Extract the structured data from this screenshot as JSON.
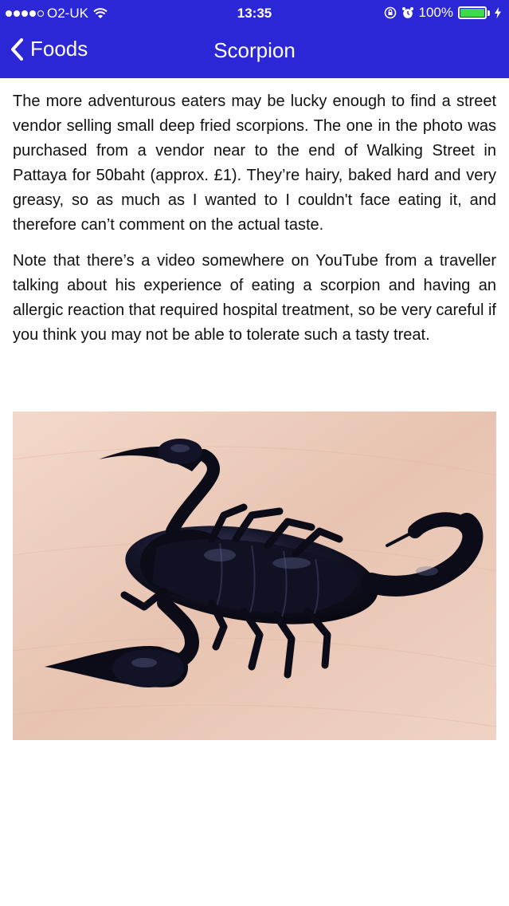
{
  "status_bar": {
    "carrier": "O2-UK",
    "time": "13:35",
    "battery": "100%"
  },
  "nav": {
    "back_label": "Foods",
    "title": "Scorpion"
  },
  "article": {
    "paragraphs": [
      "The more adventurous eaters may be lucky enough to find a street vendor selling small deep fried scorpions. The one in the photo was purchased from a vendor near to the end of Walking Street in Pattaya for 50baht (approx. £1). They’re hairy, baked hard and very greasy, so as much as I wanted to I couldn't face eating it, and therefore can’t comment on the actual taste.",
      "Note that there’s a video somewhere on YouTube from a traveller talking about his experience of eating a scorpion and having an allergic reaction that required hospital treatment, so be very careful if you think you may not be able to tolerate such a tasty treat."
    ]
  },
  "colors": {
    "nav_background": "#2b26d6",
    "text": "#111111",
    "battery_fill": "#3ed94c"
  },
  "icons": [
    "signal-dots",
    "wifi-icon",
    "lock-rotation-icon",
    "alarm-icon",
    "battery-icon",
    "charging-icon",
    "back-chevron-icon"
  ]
}
